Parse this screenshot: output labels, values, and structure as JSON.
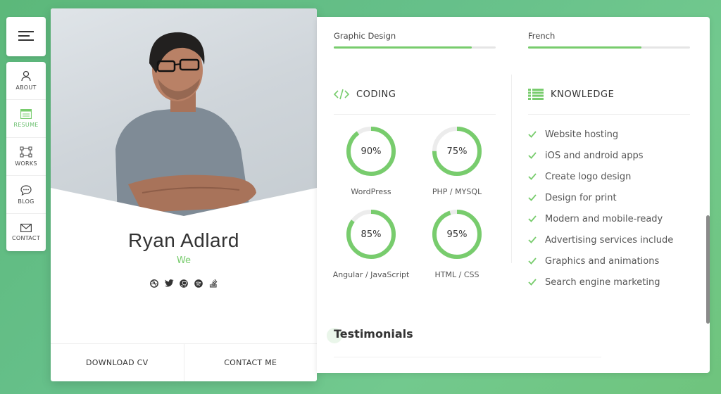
{
  "nav": {
    "items": [
      {
        "label": "ABOUT",
        "icon": "user-icon",
        "active": false
      },
      {
        "label": "RESUME",
        "icon": "resume-icon",
        "active": true
      },
      {
        "label": "WORKS",
        "icon": "works-icon",
        "active": false
      },
      {
        "label": "BLOG",
        "icon": "chat-icon",
        "active": false
      },
      {
        "label": "CONTACT",
        "icon": "mail-icon",
        "active": false
      }
    ]
  },
  "profile": {
    "name": "Ryan Adlard",
    "subtitle": "We",
    "socials": [
      "dribbble-icon",
      "twitter-icon",
      "github-icon",
      "spotify-icon",
      "stackoverflow-icon"
    ],
    "download_label": "DOWNLOAD CV",
    "contact_label": "CONTACT ME"
  },
  "skills": [
    {
      "label": "Graphic Design",
      "level": 0.85
    },
    {
      "label": "French",
      "level": 0.7
    }
  ],
  "coding": {
    "title": "CODING",
    "items": [
      {
        "label": "WordPress",
        "percent": "90%",
        "value": 90
      },
      {
        "label": "PHP / MYSQL",
        "percent": "75%",
        "value": 75
      },
      {
        "label": "Angular / JavaScript",
        "percent": "85%",
        "value": 85
      },
      {
        "label": "HTML / CSS",
        "percent": "95%",
        "value": 95
      }
    ]
  },
  "knowledge": {
    "title": "KNOWLEDGE",
    "items": [
      "Website hosting",
      "iOS and android apps",
      "Create logo design",
      "Design for print",
      "Modern and mobile-ready",
      "Advertising services include",
      "Graphics and animations",
      "Search engine marketing"
    ]
  },
  "testimonials": {
    "title": "Testimonials"
  },
  "colors": {
    "accent": "#78cc6d",
    "background": "#66c08a"
  }
}
